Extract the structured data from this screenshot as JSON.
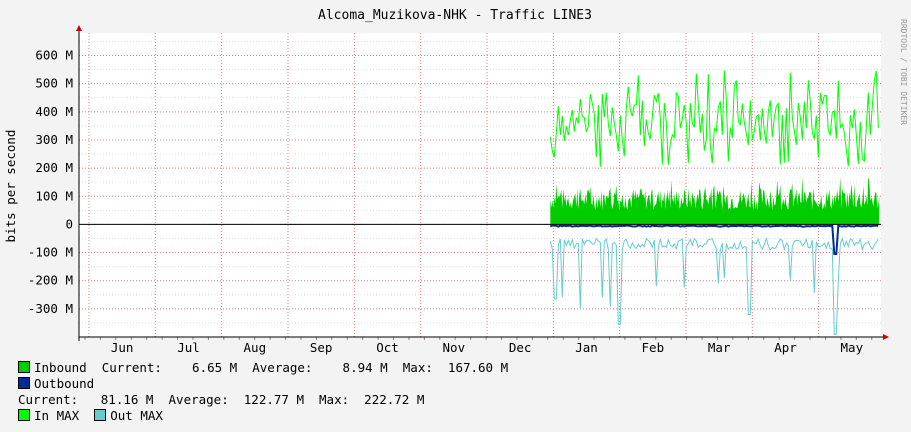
{
  "chart_data": {
    "type": "area",
    "title": "Alcoma_Muzikova-NHK - Traffic LINE3",
    "ylabel": "bits per second",
    "watermark": "RRDTOOL / TOBI OETIKER",
    "ylim": [
      -400,
      680
    ],
    "y_ticks": [
      600,
      500,
      400,
      300,
      200,
      100,
      0,
      -100,
      -200,
      -300
    ],
    "y_tick_labels": [
      "600 M",
      "500 M",
      "400 M",
      "300 M",
      "200 M",
      "100 M",
      "0",
      "-100 M",
      "-200 M",
      "-300 M"
    ],
    "x_labels": [
      "Jun",
      "Jul",
      "Aug",
      "Sep",
      "Oct",
      "Nov",
      "Dec",
      "Jan",
      "Feb",
      "Mar",
      "Apr",
      "May"
    ],
    "grid": true,
    "series": [
      {
        "name": "Inbound",
        "color": "#00cc00",
        "style": "area",
        "values_summary": "0-170 M from Jan to end of May"
      },
      {
        "name": "Outbound",
        "color": "#002a97",
        "style": "line",
        "values_summary": "about -5 M, spike near -105 M in mid May"
      },
      {
        "name": "In MAX",
        "color": "#00ff00",
        "style": "line",
        "values_summary": "200-560 M from Jan to end of May"
      },
      {
        "name": "Out MAX",
        "color": "#66cccc",
        "style": "line",
        "values_summary": "-40 to -390 M from Jan to end of May"
      }
    ],
    "stats": {
      "inbound": {
        "current": "6.65 M",
        "average": "8.94 M",
        "max": "167.60 M"
      },
      "outbound": {
        "current": "81.16 M",
        "average": "122.77 M",
        "max": "222.72 M"
      }
    }
  },
  "legend": {
    "inbound_label": "Inbound",
    "inbound_stats": "  Current:    6.65 M  Average:    8.94 M  Max:  167.60 M",
    "outbound_label": "Outbound",
    "outbound_stats": "Current:   81.16 M  Average:  122.77 M  Max:  222.72 M",
    "inmax_label": "In MAX",
    "outmax_label": "Out MAX"
  },
  "colors": {
    "background": "#f3f3f3",
    "plot_background": "#ffffff",
    "grid_major": "#e08080",
    "grid_minor": "#dddddd",
    "inbound": "#00cc00",
    "outbound": "#002a97",
    "in_max": "#00ff00",
    "out_max": "#66cccc"
  }
}
